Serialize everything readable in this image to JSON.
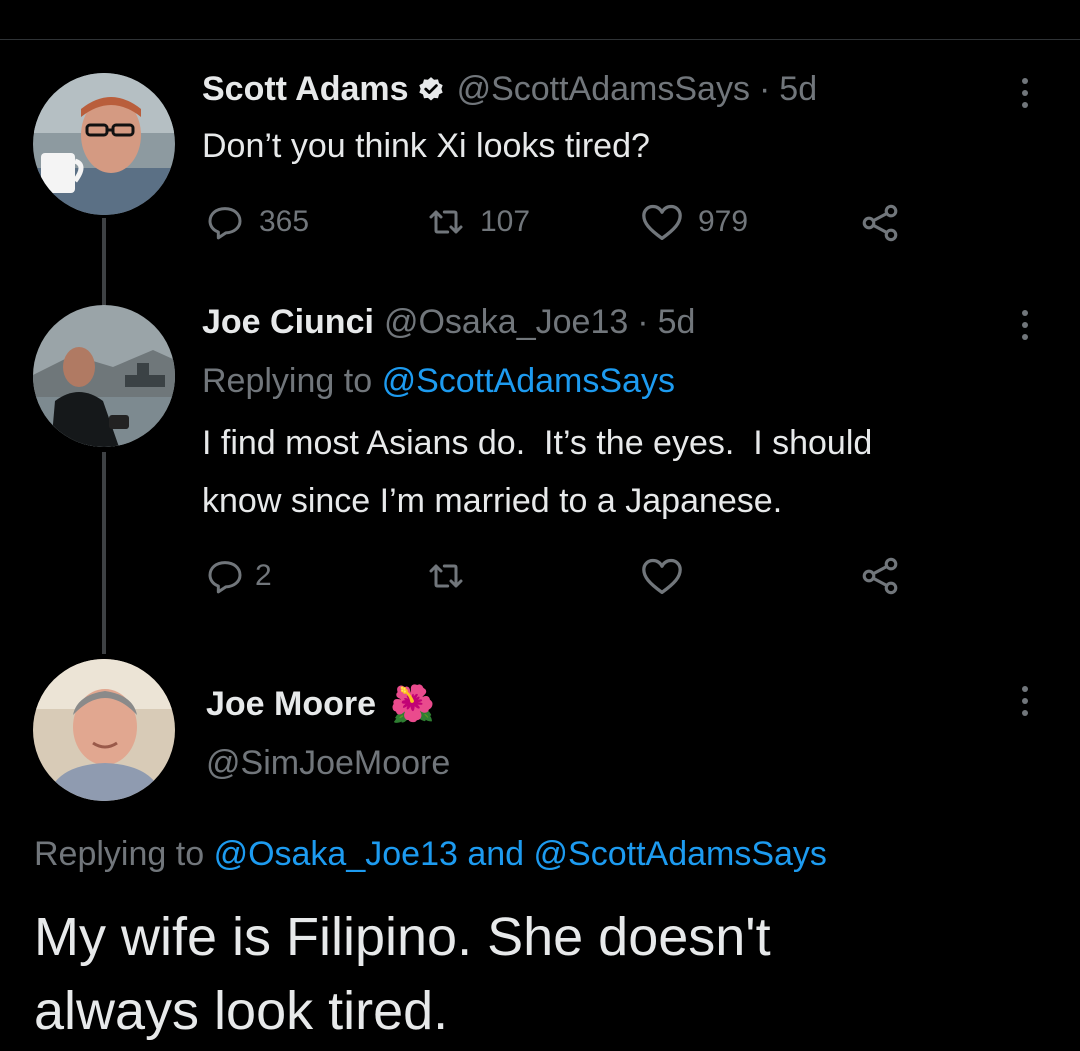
{
  "tweets": [
    {
      "name": "Scott Adams",
      "handle": "@ScottAdamsSays",
      "time": "5d",
      "text": "Don’t you think Xi looks tired?",
      "replies": "365",
      "retweets": "107",
      "likes": "979"
    },
    {
      "name": "Joe Ciunci",
      "handle": "@Osaka_Joe13",
      "time": "5d",
      "replying_prefix": "Replying to",
      "replying_to": "@ScottAdamsSays",
      "text_line1": "I find most Asians do.  It’s the eyes.  I should",
      "text_line2": "know since I’m married to a Japanese.",
      "replies": "2"
    }
  ],
  "focused_tweet": {
    "name": "Joe Moore",
    "emoji": "🌺",
    "handle": "@SimJoeMoore",
    "replying_prefix": "Replying to",
    "replying_to_1": "@Osaka_Joe13",
    "replying_and": "and",
    "replying_to_2": "@ScottAdamsSays",
    "text_line1": "My wife is Filipino. She doesn't",
    "text_line2": "always look tired."
  },
  "colors": {
    "background": "#000000",
    "primary_text": "#e7e9ea",
    "secondary_text": "#71767b",
    "link": "#1d9bf0",
    "verified": "#e7e9ea"
  },
  "icons": [
    "verified-badge-icon",
    "more-icon",
    "reply-icon",
    "retweet-icon",
    "like-icon",
    "share-icon",
    "hibiscus-emoji"
  ]
}
